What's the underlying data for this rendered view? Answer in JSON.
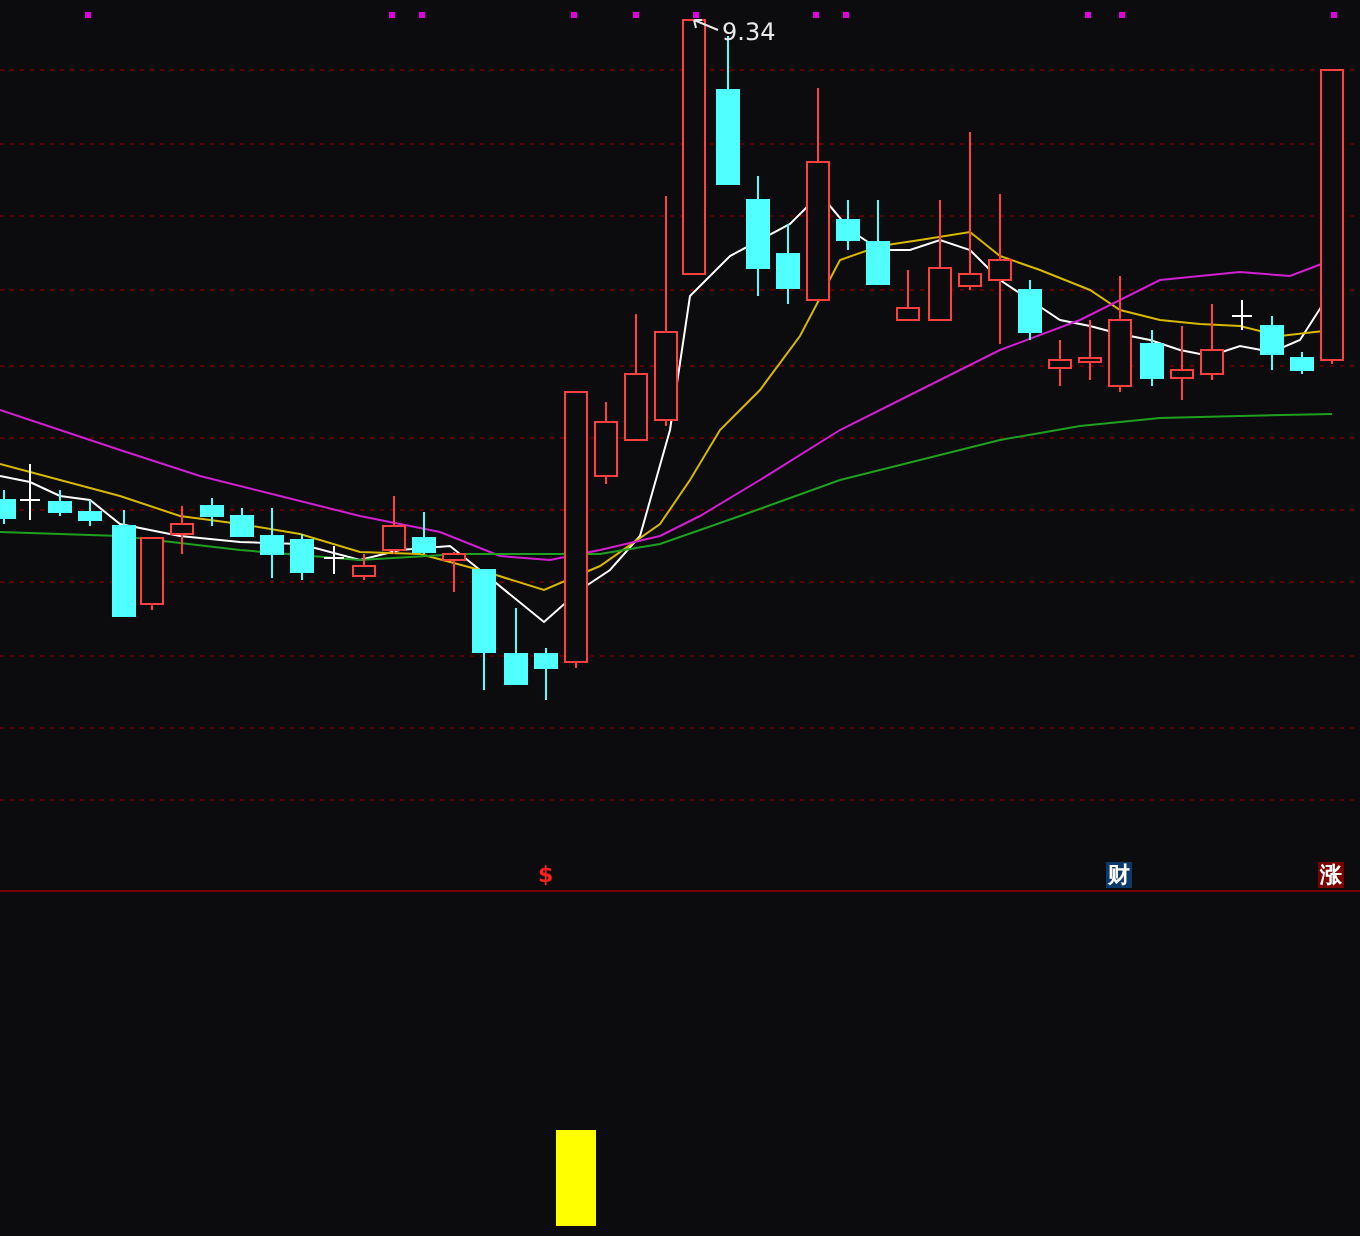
{
  "price_chart": {
    "high_label": "9.34"
  },
  "markers": [
    {
      "label": "$",
      "kind": "dollar"
    },
    {
      "label": "财",
      "kind": "finance"
    },
    {
      "label": "涨",
      "kind": "rise"
    }
  ]
}
